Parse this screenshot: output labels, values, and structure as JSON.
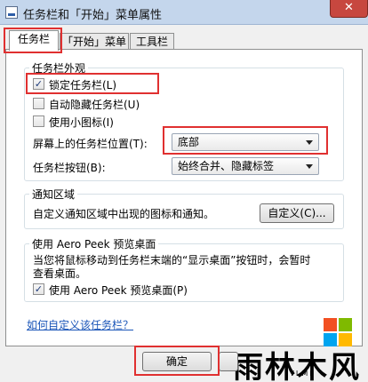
{
  "window": {
    "title": "任务栏和「开始」菜单属性",
    "close_glyph": "✕"
  },
  "tabs": [
    {
      "label": "任务栏"
    },
    {
      "label": "「开始」菜单"
    },
    {
      "label": "工具栏"
    }
  ],
  "appearance": {
    "title": "任务栏外观",
    "lock": {
      "label": "锁定任务栏(L)",
      "checked": true
    },
    "autohide": {
      "label": "自动隐藏任务栏(U)",
      "checked": false
    },
    "small_icons": {
      "label": "使用小图标(I)",
      "checked": false
    },
    "position": {
      "label": "屏幕上的任务栏位置(T):",
      "value": "底部"
    },
    "buttons": {
      "label": "任务栏按钮(B):",
      "value": "始终合并、隐藏标签"
    }
  },
  "notification": {
    "title": "通知区域",
    "description": "自定义通知区域中出现的图标和通知。",
    "customize_label": "自定义(C)..."
  },
  "aero_peek": {
    "title": "使用 Aero Peek 预览桌面",
    "description_line1": "当您将鼠标移动到任务栏末端的“显示桌面”按钮时，会暂时",
    "description_line2": "查看桌面。",
    "checkbox": {
      "label": "使用 Aero Peek 预览桌面(P)",
      "checked": true
    }
  },
  "help_link": "如何自定义该任务栏？",
  "footer": {
    "ok_label": "确定"
  },
  "watermark": {
    "text": "雨林木风",
    "sub": "YLMF"
  },
  "colors": {
    "highlight": "#e03030",
    "link": "#1a55b8",
    "titlebar": "#c4d6ec",
    "close": "#c7473f"
  }
}
